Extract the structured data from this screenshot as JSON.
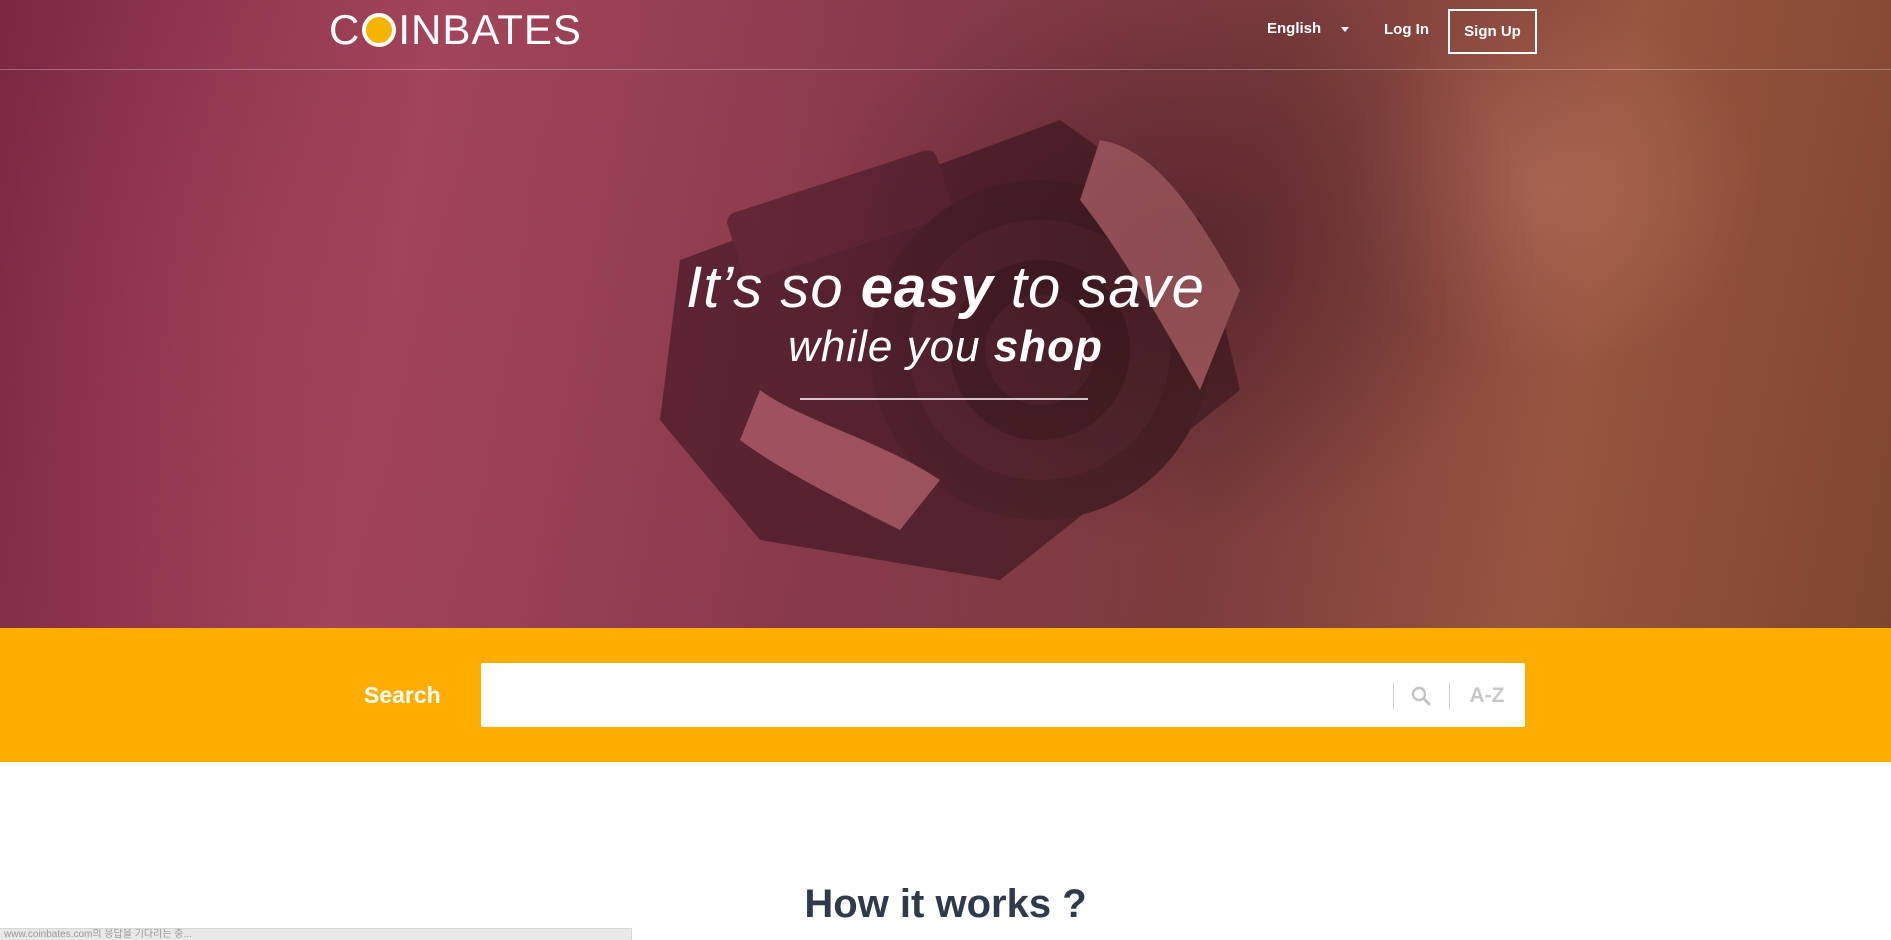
{
  "header": {
    "logo_text_left": "C",
    "logo_text_right": "INBATES",
    "language": "English",
    "login_label": "Log In",
    "signup_label": "Sign Up"
  },
  "hero": {
    "line1_a": "It’s so ",
    "line1_b": "easy",
    "line1_c": " to save",
    "line2_a": "while you ",
    "line2_b": "shop"
  },
  "search": {
    "label": "Search",
    "placeholder": "",
    "az_label": "A-Z"
  },
  "how_it_works": {
    "title": "How it works ?"
  },
  "status_bar": {
    "text": "www.coinbates.com의 응답을 기다리는 중..."
  },
  "colors": {
    "accent": "#ffae00",
    "coin": "#f5b400",
    "heading": "#2f3a4a"
  }
}
